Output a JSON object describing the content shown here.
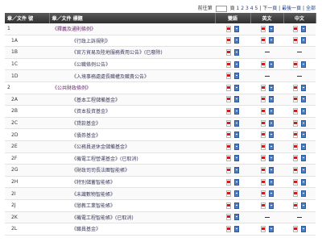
{
  "pager": {
    "prev_label": "前往第",
    "page_label": "頁",
    "pages": [
      "1",
      "2",
      "3",
      "4",
      "5"
    ],
    "next_label": "下一頁",
    "last_label": "最後一頁",
    "all_label": "全部",
    "separator": "|"
  },
  "table": {
    "headers": {
      "doc_no": "章／文件 號",
      "title": "章／文件 標題",
      "bilingual": "雙語",
      "english": "英文",
      "chinese": "中文"
    },
    "rows": [
      {
        "num": "1",
        "title": "《釋義及通則條例》",
        "level": "top",
        "bi": [
          "pdf",
          "doc"
        ],
        "en": [
          "pdf",
          "doc"
        ],
        "zh": [
          "pdf",
          "doc"
        ]
      },
      {
        "num": "1A",
        "title": "《行政上訴規則》",
        "level": "sub",
        "bi": [
          "pdf",
          "doc"
        ],
        "en": [
          "pdf",
          "doc"
        ],
        "zh": [
          "pdf",
          "doc"
        ]
      },
      {
        "num": "1B",
        "title": "《官方貿易及陸地服務費用公告》(已廢除)",
        "level": "sub",
        "bi": [
          "pdf",
          "doc"
        ],
        "en": [
          "dash"
        ],
        "zh": [
          "dash"
        ]
      },
      {
        "num": "1C",
        "title": "《公職條例公告》",
        "level": "sub",
        "bi": [
          "pdf",
          "doc"
        ],
        "en": [
          "pdf",
          "doc"
        ],
        "zh": [
          "pdf",
          "doc"
        ]
      },
      {
        "num": "1D",
        "title": "《入境事務處處長職權及職責公告》",
        "level": "sub",
        "bi": [
          "pdf",
          "doc"
        ],
        "en": [
          "dash"
        ],
        "zh": [
          "dash"
        ]
      },
      {
        "num": "2",
        "title": "《公共財政條例》",
        "level": "top",
        "bi": [
          "pdf",
          "doc"
        ],
        "en": [
          "pdf",
          "doc"
        ],
        "zh": [
          "pdf",
          "doc"
        ]
      },
      {
        "num": "2A",
        "title": "《基本工程儲備基金》",
        "level": "sub",
        "bi": [
          "pdf",
          "doc"
        ],
        "en": [
          "pdf",
          "doc"
        ],
        "zh": [
          "pdf",
          "doc"
        ]
      },
      {
        "num": "2B",
        "title": "《資本投資基金》",
        "level": "sub",
        "bi": [
          "pdf",
          "doc"
        ],
        "en": [
          "pdf",
          "doc"
        ],
        "zh": [
          "pdf",
          "doc"
        ]
      },
      {
        "num": "2C",
        "title": "《貸款基金》",
        "level": "sub",
        "bi": [
          "pdf",
          "doc"
        ],
        "en": [
          "pdf",
          "doc"
        ],
        "zh": [
          "pdf",
          "doc"
        ]
      },
      {
        "num": "2D",
        "title": "《債券基金》",
        "level": "sub",
        "bi": [
          "pdf",
          "doc"
        ],
        "en": [
          "pdf",
          "doc"
        ],
        "zh": [
          "pdf",
          "doc"
        ]
      },
      {
        "num": "2E",
        "title": "《公務員退休金儲備基金》",
        "level": "sub",
        "bi": [
          "pdf",
          "doc"
        ],
        "en": [
          "pdf",
          "doc"
        ],
        "zh": [
          "pdf",
          "doc"
        ]
      },
      {
        "num": "2F",
        "title": "《機電工程營運基金》(已取消)",
        "level": "sub",
        "bi": [
          "pdf",
          "doc"
        ],
        "en": [
          "pdf",
          "doc"
        ],
        "zh": [
          "pdf",
          "doc"
        ]
      },
      {
        "num": "2G",
        "title": "《財政司司長法團智能帳》",
        "level": "sub",
        "bi": [
          "pdf",
          "doc"
        ],
        "en": [
          "pdf",
          "doc"
        ],
        "zh": [
          "pdf",
          "doc"
        ]
      },
      {
        "num": "2H",
        "title": "《特別儲蓄智能帳》",
        "level": "sub",
        "bi": [
          "pdf",
          "doc"
        ],
        "en": [
          "pdf",
          "doc"
        ],
        "zh": [
          "pdf",
          "doc"
        ]
      },
      {
        "num": "2I",
        "title": "《未識數物智能帳》",
        "level": "sub",
        "bi": [
          "pdf",
          "doc"
        ],
        "en": [
          "pdf",
          "doc"
        ],
        "zh": [
          "pdf",
          "doc"
        ]
      },
      {
        "num": "2J",
        "title": "《懲教工業智能帳》",
        "level": "sub",
        "bi": [
          "pdf",
          "doc"
        ],
        "en": [
          "pdf",
          "doc"
        ],
        "zh": [
          "pdf",
          "doc"
        ]
      },
      {
        "num": "2K",
        "title": "《機電工程智能帳》(已取消)",
        "level": "sub",
        "bi": [
          "pdf",
          "doc"
        ],
        "en": [
          "dash"
        ],
        "zh": [
          "dash"
        ]
      },
      {
        "num": "2L",
        "title": "《職員基金》",
        "level": "sub",
        "bi": [
          "pdf",
          "doc"
        ],
        "en": [
          "pdf",
          "doc"
        ],
        "zh": [
          "pdf",
          "doc"
        ]
      }
    ]
  },
  "icons": {
    "pdf": "pdf-file-icon",
    "doc": "word-doc-icon",
    "dash": "not-available-dash"
  },
  "colors": {
    "header_bg": "#3a3a3a",
    "link": "#1a3f9a",
    "top_title": "#6a2a6f",
    "pdf_red": "#cc1b1b",
    "doc_blue": "#4f7ec4"
  }
}
